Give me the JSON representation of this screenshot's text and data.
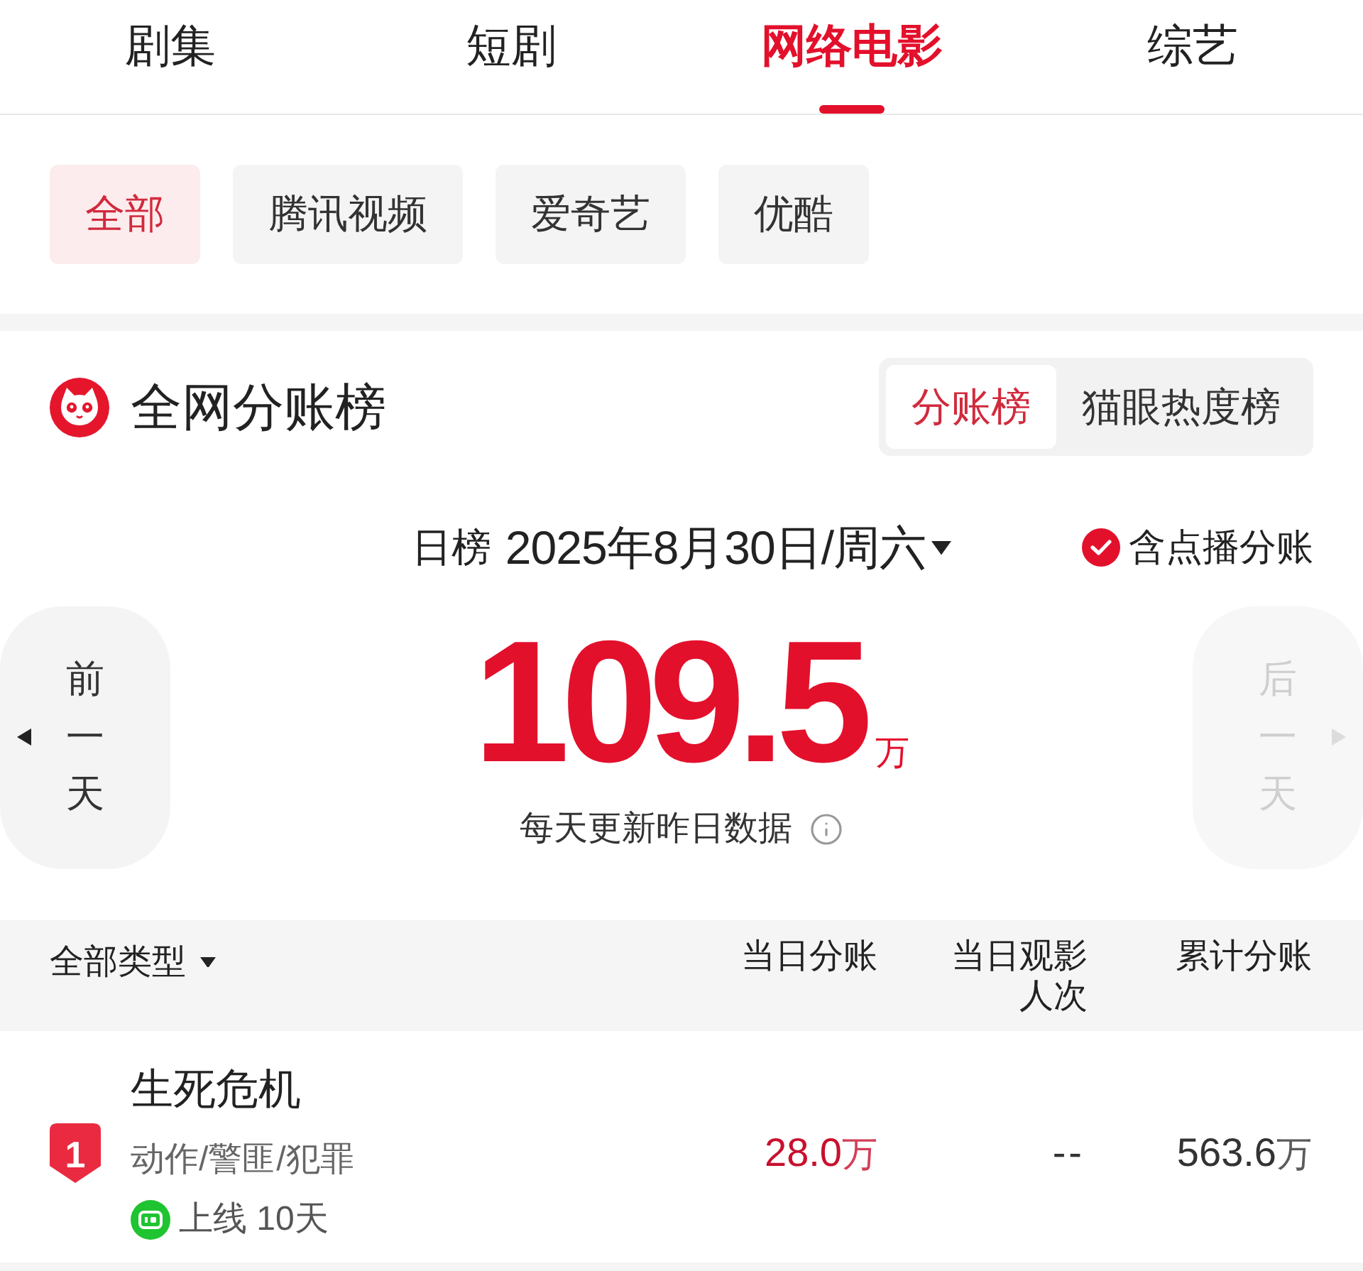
{
  "top_tabs": [
    {
      "label": "剧集",
      "selected": false
    },
    {
      "label": "短剧",
      "selected": false
    },
    {
      "label": "网络电影",
      "selected": true
    },
    {
      "label": "综艺",
      "selected": false
    }
  ],
  "platform_filters": [
    {
      "label": "全部",
      "selected": true
    },
    {
      "label": "腾讯视频",
      "selected": false
    },
    {
      "label": "爱奇艺",
      "selected": false
    },
    {
      "label": "优酷",
      "selected": false
    }
  ],
  "ranking": {
    "title": "全网分账榜",
    "view_tabs": [
      {
        "label": "分账榜",
        "selected": true
      },
      {
        "label": "猫眼热度榜",
        "selected": false
      }
    ]
  },
  "date_bar": {
    "period": "日榜",
    "date": "2025年8月30日/周六",
    "include_vod": {
      "label": "含点播分账",
      "checked": true
    }
  },
  "day_nav": {
    "previous": {
      "label": "前一天",
      "disabled": false
    },
    "next": {
      "label": "后一天",
      "disabled": true
    }
  },
  "total": {
    "value": "109.5",
    "unit": "万",
    "note": "每天更新昨日数据"
  },
  "table": {
    "type_filter": "全部类型",
    "columns": [
      "当日分账",
      "当日观影人次",
      "累计分账"
    ],
    "rows": [
      {
        "rank": "1",
        "title": "生死危机",
        "genres": "动作/警匪/犯罪",
        "kind": "iqiyi",
        "online": "上线 10天",
        "daily_share": {
          "value": "28.0",
          "unit": "万"
        },
        "daily_viewers": "--",
        "total_share": {
          "value": "563.6",
          "unit": "万"
        }
      }
    ]
  }
}
